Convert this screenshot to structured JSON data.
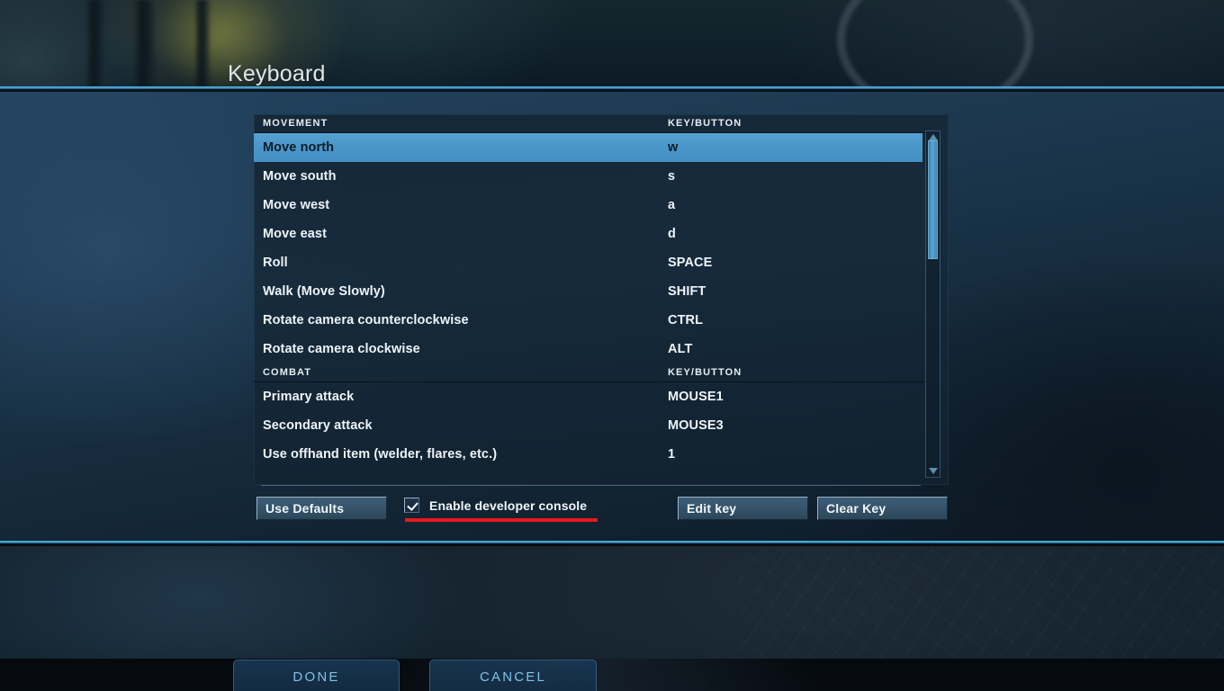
{
  "page_title": "Keyboard",
  "colors": {
    "accent": "#4b96c9",
    "divider": "#3f9ac8",
    "panel_bg": "#16293b",
    "highlight_row": "#4b96c9",
    "warning_underline": "#e8191b",
    "action_text": "#7fc2e4"
  },
  "bindings_panel": {
    "sections": [
      {
        "name": "MOVEMENT",
        "key_column_header": "KEY/BUTTON",
        "rows": [
          {
            "action": "Move north",
            "key": "w",
            "selected": true
          },
          {
            "action": "Move south",
            "key": "s",
            "selected": false
          },
          {
            "action": "Move west",
            "key": "a",
            "selected": false
          },
          {
            "action": "Move east",
            "key": "d",
            "selected": false
          },
          {
            "action": "Roll",
            "key": "SPACE",
            "selected": false
          },
          {
            "action": "Walk (Move Slowly)",
            "key": "SHIFT",
            "selected": false
          },
          {
            "action": "Rotate camera counterclockwise",
            "key": "CTRL",
            "selected": false
          },
          {
            "action": "Rotate camera clockwise",
            "key": "ALT",
            "selected": false
          }
        ]
      },
      {
        "name": "COMBAT",
        "key_column_header": "KEY/BUTTON",
        "rows": [
          {
            "action": "Primary attack",
            "key": "MOUSE1",
            "selected": false
          },
          {
            "action": "Secondary attack",
            "key": "MOUSE3",
            "selected": false
          },
          {
            "action": "Use offhand item (welder, flares, etc.)",
            "key": "1",
            "selected": false
          }
        ]
      }
    ],
    "scrollbar": {
      "up_arrow": "scroll-up-arrow",
      "down_arrow": "scroll-down-arrow"
    }
  },
  "footer": {
    "use_defaults_label": "Use Defaults",
    "developer_console_label": "Enable developer console",
    "developer_console_checked": true,
    "edit_key_label": "Edit key",
    "clear_key_label": "Clear Key"
  },
  "actions": {
    "done_label": "DONE",
    "cancel_label": "CANCEL"
  }
}
